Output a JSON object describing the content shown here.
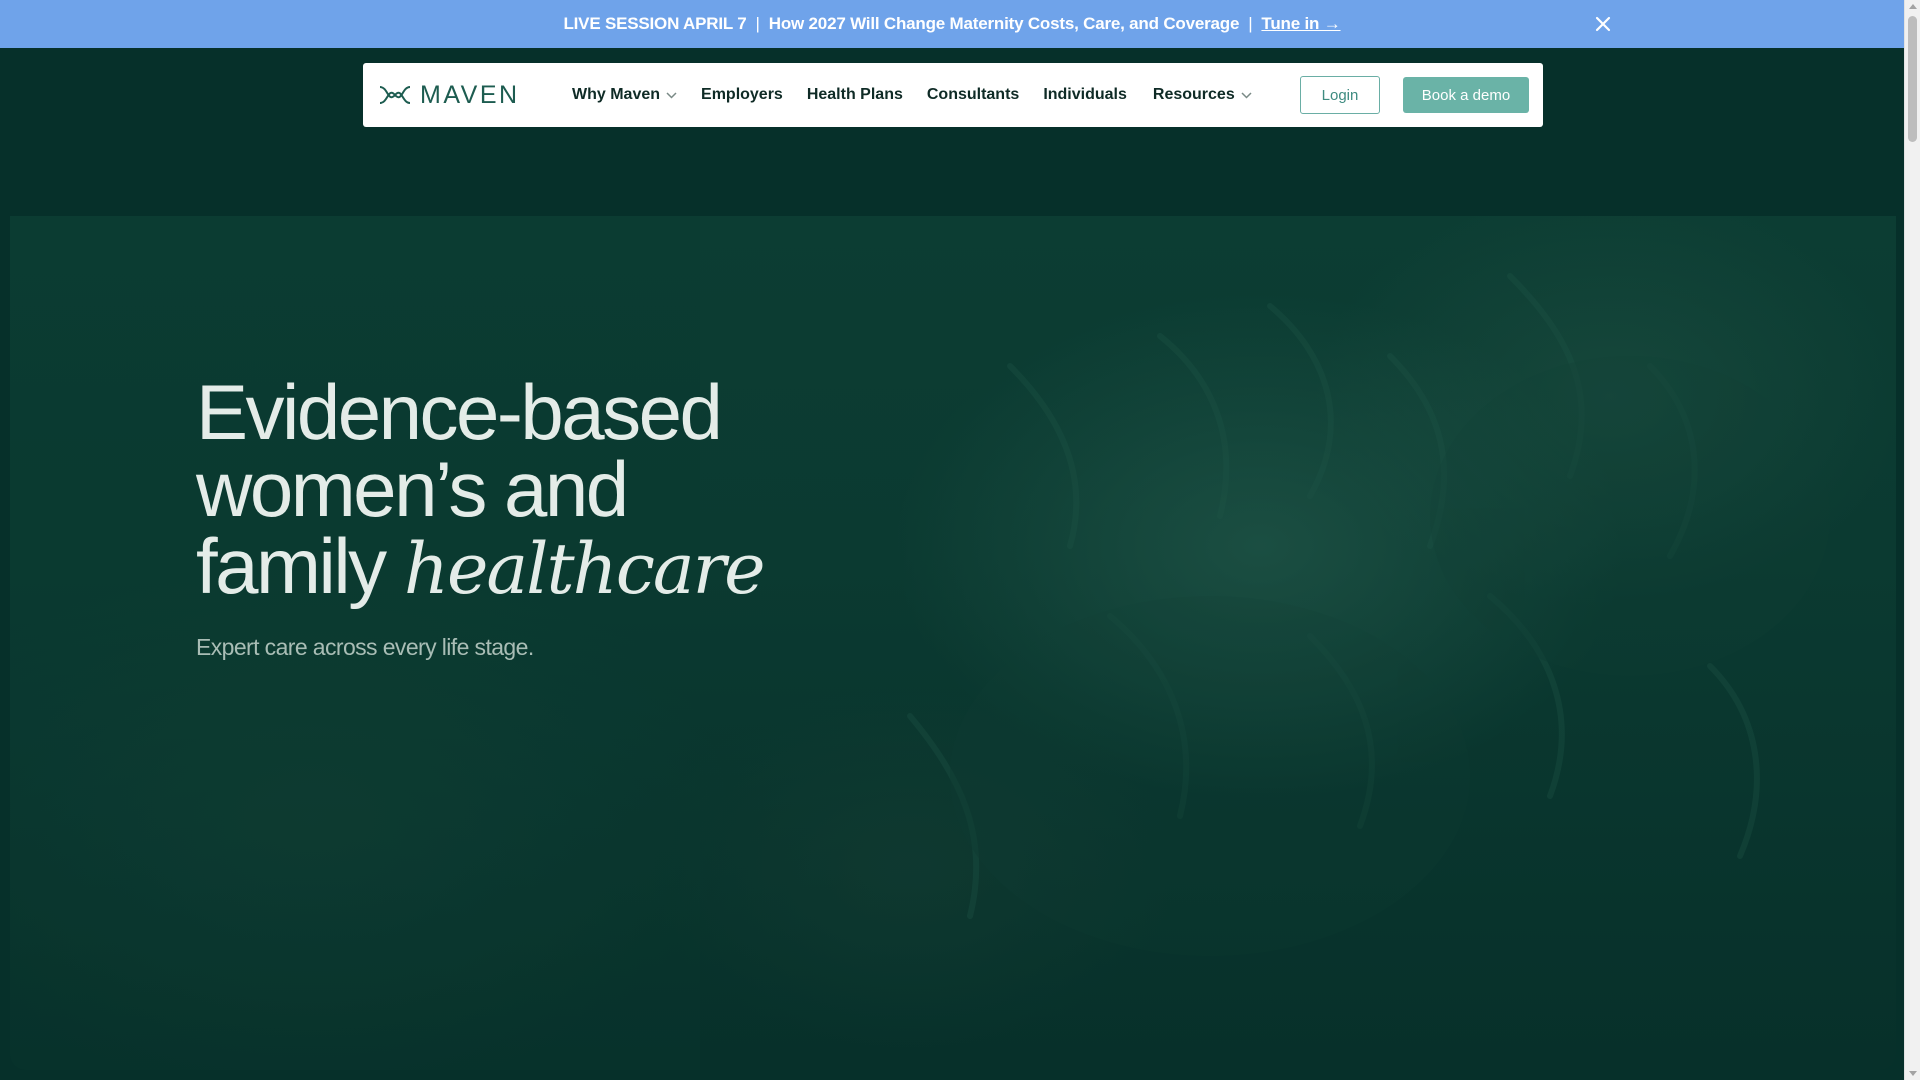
{
  "announcement": {
    "label": "LIVE SESSION APRIL 7",
    "separator": "|",
    "message": "How 2027 Will Change Maternity Costs, Care, and Coverage",
    "cta": "Tune in →",
    "close_icon": "close-icon"
  },
  "nav": {
    "logo_text": "MAVEN",
    "logo_icon": "maven-logo-mark-icon",
    "links": [
      {
        "label": "Why Maven",
        "has_dropdown": true
      },
      {
        "label": "Employers",
        "has_dropdown": false
      },
      {
        "label": "Health Plans",
        "has_dropdown": false
      },
      {
        "label": "Consultants",
        "has_dropdown": false
      },
      {
        "label": "Individuals",
        "has_dropdown": false
      },
      {
        "label": "Resources",
        "has_dropdown": true
      }
    ],
    "login_label": "Login",
    "demo_label": "Book a demo"
  },
  "hero": {
    "title_line1": "Evidence-based",
    "title_line2": "women’s and",
    "title_line3_plain": "family ",
    "title_line3_em": "healthcare",
    "subtitle": "Expert care across every life stage."
  },
  "colors": {
    "announcement_bg": "#6fa3ea",
    "page_bg": "#06302a",
    "brand_teal": "#1d5c50",
    "demo_button": "#6ab3a7",
    "login_border": "#6aaea5"
  }
}
